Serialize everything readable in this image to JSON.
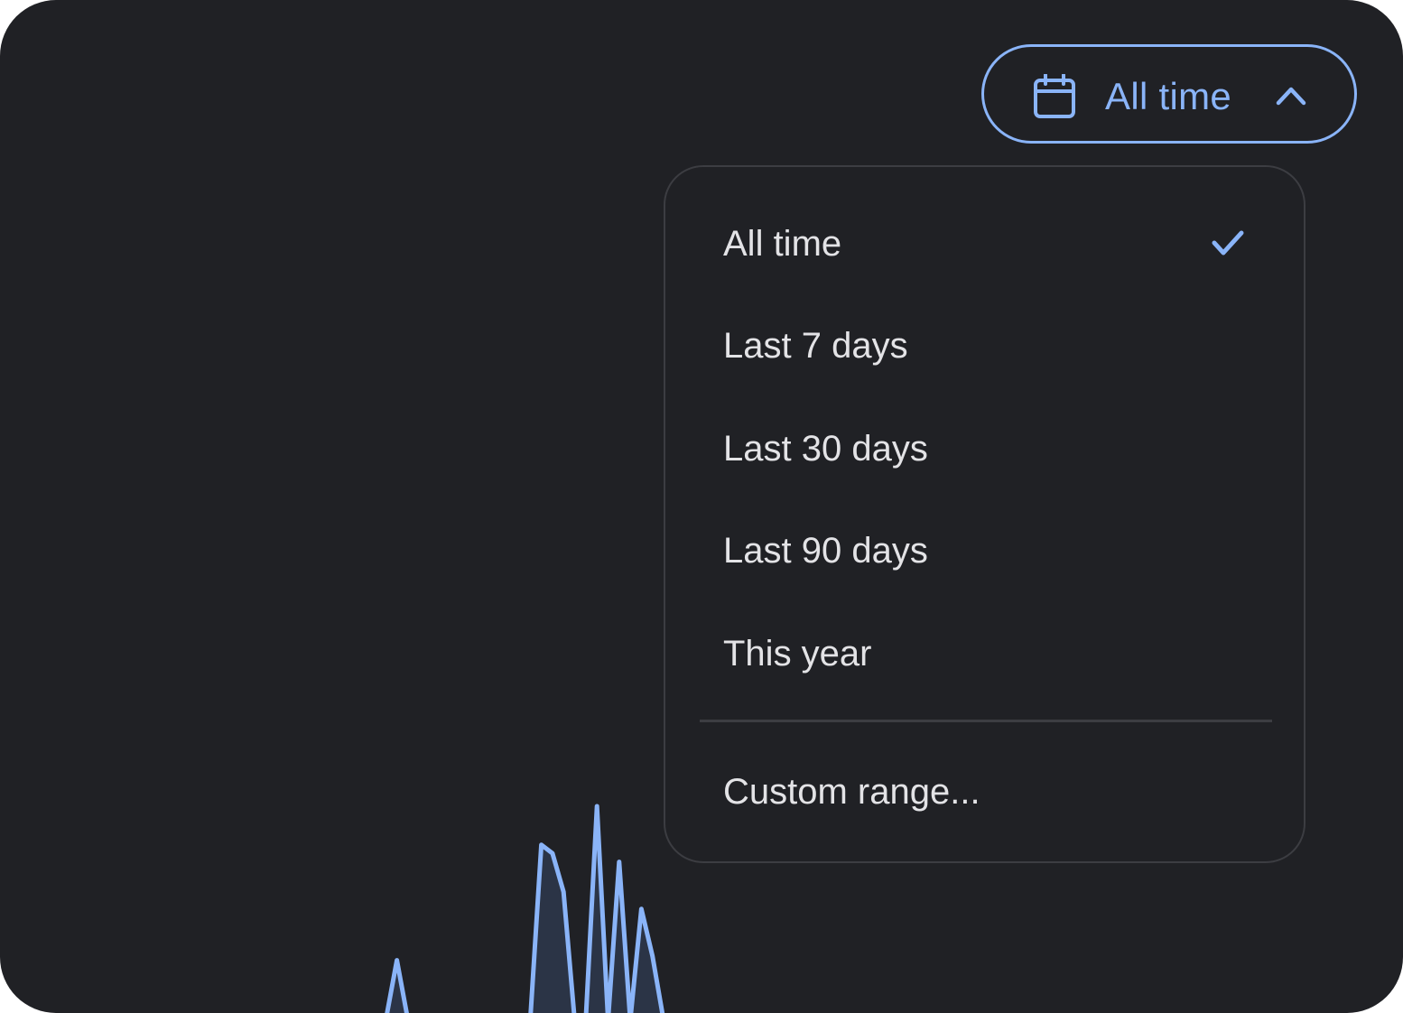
{
  "date_range_button": {
    "label": "All time",
    "icon": "calendar-icon",
    "toggle_icon": "chevron-up-icon"
  },
  "dropdown": {
    "selected_index": 0,
    "selected_icon": "checkmark-icon",
    "options": [
      {
        "label": "All time"
      },
      {
        "label": "Last 7 days"
      },
      {
        "label": "Last 30 days"
      },
      {
        "label": "Last 90 days"
      },
      {
        "label": "This year"
      }
    ],
    "custom_option": "Custom range..."
  },
  "colors": {
    "background": "#202125",
    "accent": "#8ab4f8",
    "text": "#e3e3e6",
    "border": "#3c3d42",
    "chart_fill": "#2b3446"
  },
  "chart_data": {
    "type": "area",
    "series": [
      {
        "values": [
          0.0,
          0.02,
          0.0,
          0.0,
          0.0,
          0.0,
          0.0,
          0.0,
          0.0,
          0.0,
          0.0,
          0.0,
          0.0,
          0.0,
          0.0,
          0.0,
          0.0,
          0.0,
          0.0,
          0.0,
          0.0,
          0.0,
          0.0,
          0.0,
          0.0,
          0.0,
          0.0,
          0.0,
          0.28,
          0.0,
          0.0,
          0.0,
          0.0,
          0.0,
          0.0,
          0.0,
          0.0,
          0.0,
          0.0,
          0.0,
          0.0,
          0.82,
          0.78,
          0.6,
          0.0,
          0.0,
          1.0,
          0.0,
          0.74,
          0.0,
          0.52,
          0.3,
          0.0
        ]
      }
    ]
  }
}
